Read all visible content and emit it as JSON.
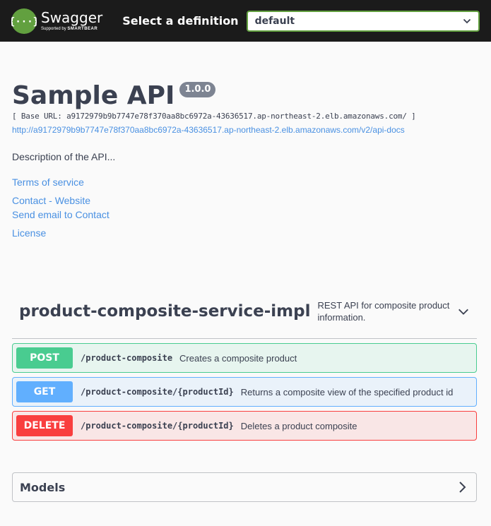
{
  "topbar": {
    "logo_title": "Swagger",
    "logo_sub_prefix": "Supported by",
    "logo_sub_brand": "SMARTBEAR",
    "definition_label": "Select a definition",
    "definition_value": "default",
    "logo_color": "#62a03f"
  },
  "info": {
    "title": "Sample API",
    "version": "1.0.0",
    "base_url": "[ Base URL: a9172979b9b7747e78f370aa8bc6972a-43636517.ap-northeast-2.elb.amazonaws.com/ ]",
    "spec_url": "http://a9172979b9b7747e78f370aa8bc6972a-43636517.ap-northeast-2.elb.amazonaws.com/v2/api-docs",
    "description": "Description of the API...",
    "terms": "Terms of service",
    "contact_website": "Contact - Website",
    "contact_email": "Send email to Contact",
    "license": "License"
  },
  "tag": {
    "name": "product-composite-service-impl",
    "description": "REST API for composite product information."
  },
  "operations": [
    {
      "method": "POST",
      "path": "/product-composite",
      "summary": "Creates a composite product",
      "color": "#49cc90"
    },
    {
      "method": "GET",
      "path": "/product-composite/{productId}",
      "summary": "Returns a composite view of the specified product id",
      "color": "#61affe"
    },
    {
      "method": "DELETE",
      "path": "/product-composite/{productId}",
      "summary": "Deletes a product composite",
      "color": "#f93e3e"
    }
  ],
  "models": {
    "title": "Models"
  }
}
